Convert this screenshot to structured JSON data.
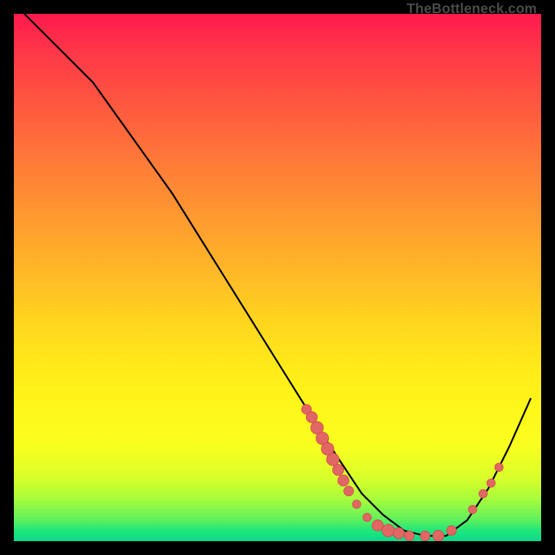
{
  "watermark": "TheBottleneck.com",
  "chart_data": {
    "type": "line",
    "title": "",
    "xlabel": "",
    "ylabel": "",
    "xlim": [
      0,
      100
    ],
    "ylim": [
      0,
      100
    ],
    "series": [
      {
        "name": "curve",
        "x": [
          2,
          6,
          10,
          15,
          20,
          25,
          30,
          35,
          40,
          45,
          50,
          55,
          58,
          62,
          66,
          70,
          74,
          78,
          82,
          86,
          90,
          94,
          98
        ],
        "y": [
          100,
          96,
          92,
          87,
          80,
          73,
          66,
          58,
          50,
          42,
          34,
          26,
          21,
          15,
          9,
          5,
          2,
          1,
          1,
          4,
          10,
          18,
          27
        ]
      }
    ],
    "markers": [
      {
        "x": 55.5,
        "y": 25.0,
        "r": 7
      },
      {
        "x": 56.5,
        "y": 23.5,
        "r": 8
      },
      {
        "x": 57.5,
        "y": 21.5,
        "r": 9
      },
      {
        "x": 58.5,
        "y": 19.5,
        "r": 9
      },
      {
        "x": 59.5,
        "y": 17.5,
        "r": 9
      },
      {
        "x": 60.5,
        "y": 15.5,
        "r": 9
      },
      {
        "x": 61.5,
        "y": 13.5,
        "r": 8
      },
      {
        "x": 62.5,
        "y": 11.5,
        "r": 8
      },
      {
        "x": 63.5,
        "y": 9.5,
        "r": 7
      },
      {
        "x": 65.0,
        "y": 7.0,
        "r": 6
      },
      {
        "x": 67.0,
        "y": 4.5,
        "r": 6
      },
      {
        "x": 69.0,
        "y": 3.0,
        "r": 8
      },
      {
        "x": 71.0,
        "y": 2.0,
        "r": 9
      },
      {
        "x": 73.0,
        "y": 1.5,
        "r": 8
      },
      {
        "x": 75.0,
        "y": 1.0,
        "r": 7
      },
      {
        "x": 78.0,
        "y": 1.0,
        "r": 7
      },
      {
        "x": 80.5,
        "y": 1.0,
        "r": 8
      },
      {
        "x": 83.0,
        "y": 2.0,
        "r": 7
      },
      {
        "x": 87.0,
        "y": 6.0,
        "r": 6
      },
      {
        "x": 89.0,
        "y": 9.0,
        "r": 6
      },
      {
        "x": 90.5,
        "y": 11.0,
        "r": 6
      },
      {
        "x": 92.0,
        "y": 14.0,
        "r": 6
      }
    ],
    "colors": {
      "curve": "#000000",
      "marker_fill": "#e16765",
      "marker_stroke": "#d14c4a"
    }
  }
}
